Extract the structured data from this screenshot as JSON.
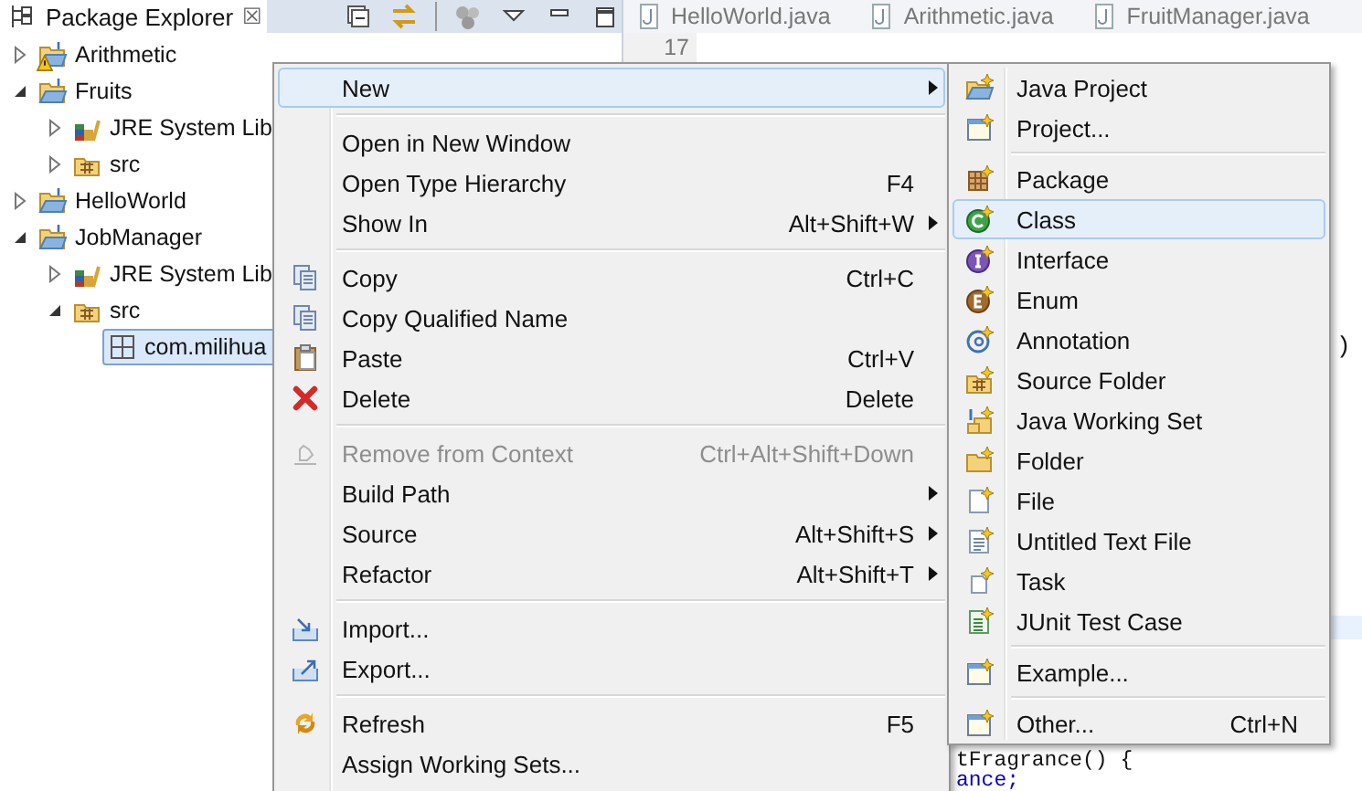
{
  "explorer": {
    "title": "Package Explorer",
    "close": "☒",
    "tree": [
      {
        "label": "Arithmetic",
        "kind": "project",
        "expanded": false,
        "warning": true,
        "selected": false
      },
      {
        "label": "Fruits",
        "kind": "project",
        "expanded": true,
        "warning": false,
        "selected": false,
        "children": [
          {
            "label": "JRE System Lib",
            "kind": "library",
            "expanded": false,
            "warning": false,
            "selected": false
          },
          {
            "label": "src",
            "kind": "source",
            "expanded": false,
            "warning": false,
            "selected": false
          }
        ]
      },
      {
        "label": "HelloWorld",
        "kind": "project",
        "expanded": false,
        "warning": false,
        "selected": false
      },
      {
        "label": "JobManager",
        "kind": "project",
        "expanded": true,
        "warning": false,
        "selected": false,
        "children": [
          {
            "label": "JRE System Lib",
            "kind": "library",
            "expanded": false,
            "warning": false,
            "selected": false
          },
          {
            "label": "src",
            "kind": "source",
            "expanded": true,
            "warning": false,
            "selected": false,
            "children": [
              {
                "label": "com.milihua",
                "kind": "package",
                "warning": false,
                "selected": true
              }
            ]
          }
        ]
      }
    ]
  },
  "editor": {
    "tabs": [
      "HelloWorld.java",
      "Arithmetic.java",
      "FruitManager.java"
    ],
    "line_number": "17",
    "code": [
      ")",
      "tFragrance() {",
      "ance;"
    ]
  },
  "context_menu": {
    "groups": [
      [
        {
          "label": "New",
          "submenu": true,
          "disabled": false,
          "selected": true
        }
      ],
      [
        {
          "label": "Open in New Window",
          "submenu": false,
          "disabled": false,
          "selected": false
        },
        {
          "label": "Open Type Hierarchy",
          "shortcut": "F4",
          "submenu": false,
          "disabled": false,
          "selected": false
        },
        {
          "label": "Show In",
          "shortcut": "Alt+Shift+W",
          "submenu": true,
          "disabled": false,
          "selected": false
        }
      ],
      [
        {
          "label": "Copy",
          "shortcut": "Ctrl+C",
          "submenu": false,
          "disabled": false,
          "selected": false
        },
        {
          "label": "Copy Qualified Name",
          "submenu": false,
          "disabled": false,
          "selected": false
        },
        {
          "label": "Paste",
          "shortcut": "Ctrl+V",
          "submenu": false,
          "disabled": false,
          "selected": false
        },
        {
          "label": "Delete",
          "shortcut": "Delete",
          "submenu": false,
          "disabled": false,
          "selected": false
        }
      ],
      [
        {
          "label": "Remove from Context",
          "shortcut": "Ctrl+Alt+Shift+Down",
          "submenu": false,
          "disabled": true,
          "selected": false
        },
        {
          "label": "Build Path",
          "submenu": true,
          "disabled": false,
          "selected": false
        },
        {
          "label": "Source",
          "shortcut": "Alt+Shift+S",
          "submenu": true,
          "disabled": false,
          "selected": false
        },
        {
          "label": "Refactor",
          "shortcut": "Alt+Shift+T",
          "submenu": true,
          "disabled": false,
          "selected": false
        }
      ],
      [
        {
          "label": "Import...",
          "submenu": false,
          "disabled": false,
          "selected": false
        },
        {
          "label": "Export...",
          "submenu": false,
          "disabled": false,
          "selected": false
        }
      ],
      [
        {
          "label": "Refresh",
          "shortcut": "F5",
          "submenu": false,
          "disabled": false,
          "selected": false
        },
        {
          "label": "Assign Working Sets...",
          "submenu": false,
          "disabled": false,
          "selected": false
        }
      ]
    ]
  },
  "new_submenu": {
    "groups": [
      [
        {
          "label": "Java Project",
          "selected": false
        },
        {
          "label": "Project...",
          "selected": false
        }
      ],
      [
        {
          "label": "Package",
          "selected": false
        },
        {
          "label": "Class",
          "selected": true
        },
        {
          "label": "Interface",
          "selected": false
        },
        {
          "label": "Enum",
          "selected": false
        },
        {
          "label": "Annotation",
          "selected": false
        },
        {
          "label": "Source Folder",
          "selected": false
        },
        {
          "label": "Java Working Set",
          "selected": false
        },
        {
          "label": "Folder",
          "selected": false
        },
        {
          "label": "File",
          "selected": false
        },
        {
          "label": "Untitled Text File",
          "selected": false
        },
        {
          "label": "Task",
          "selected": false
        },
        {
          "label": "JUnit Test Case",
          "selected": false
        }
      ],
      [
        {
          "label": "Example...",
          "selected": false
        }
      ],
      [
        {
          "label": "Other...",
          "shortcut": "Ctrl+N",
          "selected": false
        }
      ]
    ]
  }
}
